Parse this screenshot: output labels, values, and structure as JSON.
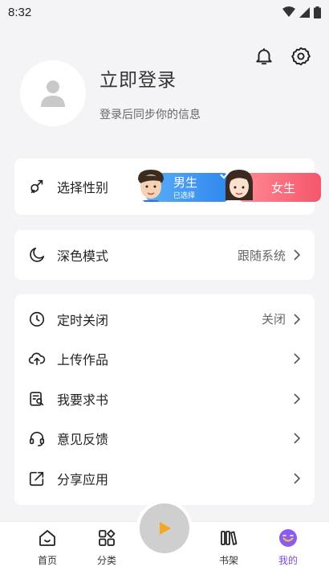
{
  "status": {
    "time": "8:32"
  },
  "profile": {
    "title": "立即登录",
    "subtitle": "登录后同步你的信息"
  },
  "gender": {
    "label": "选择性别",
    "male_label": "男生",
    "male_sub": "已选择",
    "female_label": "女生"
  },
  "dark_mode": {
    "label": "深色模式",
    "value": "跟随系统"
  },
  "menu": [
    {
      "label": "定时关闭",
      "value": "关闭"
    },
    {
      "label": "上传作品",
      "value": ""
    },
    {
      "label": "我要求书",
      "value": ""
    },
    {
      "label": "意见反馈",
      "value": ""
    },
    {
      "label": "分享应用",
      "value": ""
    }
  ],
  "tabs": [
    {
      "label": "首页"
    },
    {
      "label": "分类"
    },
    {
      "label": "书架"
    },
    {
      "label": "我的"
    }
  ],
  "colors": {
    "accent_purple": "#7b4be8",
    "male_blue": "#2f87ee",
    "female_pink": "#f5566b",
    "play_orange": "#f5a623"
  }
}
